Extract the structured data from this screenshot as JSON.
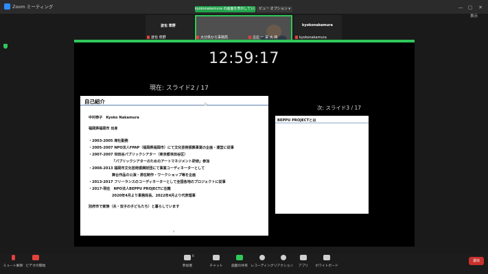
{
  "window": {
    "title": "Zoom ミーティング",
    "share_banner": "kyokonakamura の画面を表示しています",
    "view_options": "ビュー オプション ▾",
    "side_toggle": "表示",
    "controls": [
      "—",
      "▢",
      "✕"
    ]
  },
  "participants": [
    {
      "top_name": "波也 草野",
      "bottom_name": "波也 草野"
    },
    {
      "bottom_name": "大分県から事務局"
    },
    {
      "bottom_name": "古庄 一 栄 大 将"
    },
    {
      "top_name": "kyokonakamura",
      "bottom_name": "kyokonakamura"
    }
  ],
  "presenter": {
    "clock": "12:59:17",
    "current_label": "現在: スライド2 / 17",
    "next_label": "次: スライド3 / 17"
  },
  "slide_current": {
    "title": "自己紹介",
    "lines": [
      "中村恭子　Kyoko Nakamura",
      "福岡県福岡市 出身",
      "・2003-2005  商社勤務",
      "・2005-2007  NPO法人FPAP（福岡県福岡市）にて文化芸術振興事業の企画・運営に従事",
      "・2007-2007  世田谷パブリックシアター（東京都世田谷区）",
      "「パブリックシアターのためのアートマネジメント研修」参加",
      "・2008-2013  福岡市文化芸術振興財団にて事業コーディネーターとして",
      "舞台作品の公演・滞在制作・ワークショップ等を企画",
      "・2013-2017  フリーランスのコーディネーターとして全国各地のプロジェクトに従事",
      "・2017-現在　NPO法人BEPPU PROJECTに在籍",
      "2020年4月より事務局長、2022年4月より代表理事",
      "別府市で家族（夫・双子の子どもたち）と暮らしています"
    ],
    "page": "2"
  },
  "slide_next": {
    "title": "BEPPU PROJECTとは"
  },
  "toolbar": {
    "mute": "ミュート解除",
    "video": "ビデオの開始",
    "participants": "参加者",
    "participants_count": "6",
    "chat": "チャット",
    "share": "画面の共有",
    "record": "レコーディング",
    "reactions": "リアクション",
    "apps": "アプリ",
    "whiteboard": "ホワイトボード",
    "end": "退出"
  }
}
